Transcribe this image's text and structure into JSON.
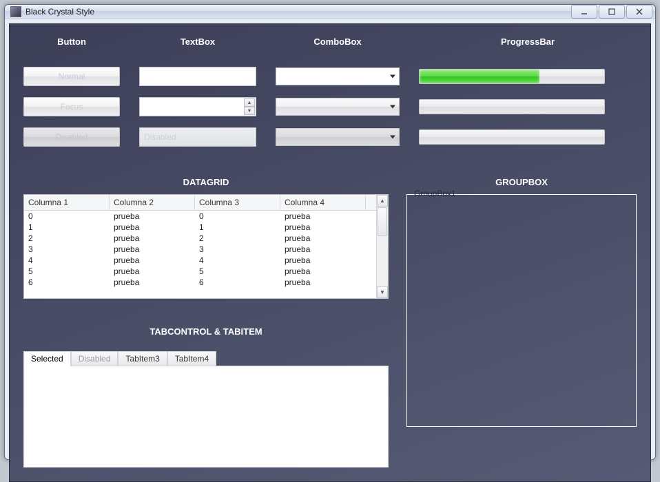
{
  "window": {
    "title": "Black Crystal Style"
  },
  "headers": {
    "button": "Button",
    "textbox": "TextBox",
    "combobox": "ComboBox",
    "progressbar": "ProgressBar"
  },
  "buttons": {
    "normal": "Normal",
    "focus": "Focus",
    "disabled": "Disabled"
  },
  "textboxes": {
    "disabled_placeholder": "Disabled"
  },
  "progress": {
    "p1_percent": 65,
    "p2_percent": 0,
    "p3_percent": 0
  },
  "sections": {
    "datagrid": "DATAGRID",
    "tabcontrol": "TABCONTROL & TABITEM",
    "groupbox": "GROUPBOX"
  },
  "datagrid": {
    "columns": [
      "Columna 1",
      "Columna 2",
      "Columna 3",
      "Columna 4"
    ],
    "rows": [
      [
        "0",
        "prueba",
        "0",
        "prueba"
      ],
      [
        "1",
        "prueba",
        "1",
        "prueba"
      ],
      [
        "2",
        "prueba",
        "2",
        "prueba"
      ],
      [
        "3",
        "prueba",
        "3",
        "prueba"
      ],
      [
        "4",
        "prueba",
        "4",
        "prueba"
      ],
      [
        "5",
        "prueba",
        "5",
        "prueba"
      ],
      [
        "6",
        "prueba",
        "6",
        "prueba"
      ]
    ]
  },
  "tabs": {
    "items": [
      {
        "label": "Selected",
        "state": "selected"
      },
      {
        "label": "Disabled",
        "state": "disabled"
      },
      {
        "label": "TabItem3",
        "state": "normal"
      },
      {
        "label": "TabItem4",
        "state": "normal"
      }
    ]
  },
  "groupbox": {
    "label": "GroupBox1"
  }
}
